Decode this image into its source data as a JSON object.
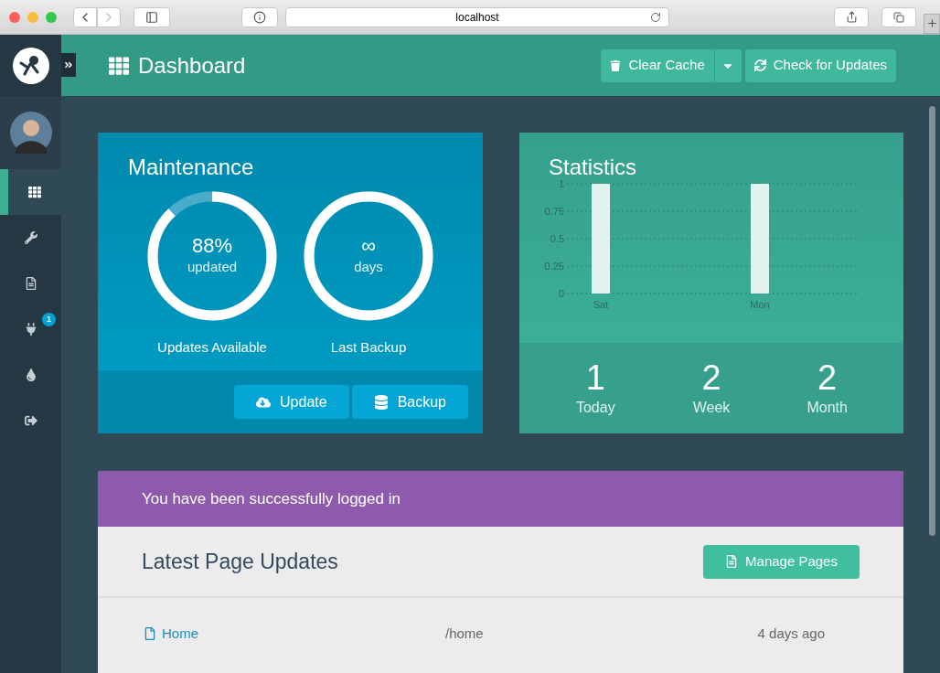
{
  "browser": {
    "url": "localhost"
  },
  "header": {
    "title": "Dashboard",
    "buttons": [
      {
        "kind": "cache",
        "label": "Clear Cache"
      },
      {
        "kind": "updates",
        "label": "Check for Updates"
      }
    ]
  },
  "sidebar": {
    "items": [
      {
        "selected": true
      },
      {
        "selected": false
      },
      {
        "selected": false
      },
      {
        "selected": false,
        "badge": "1"
      },
      {
        "selected": false
      },
      {
        "selected": false
      }
    ]
  },
  "maintenance": {
    "title": "Maintenance",
    "gauges": [
      {
        "value": "88%",
        "unit": "updated",
        "label": "Updates Available",
        "level": 0.88
      },
      {
        "value": "∞",
        "unit": "days",
        "label": "Last Backup",
        "level": 1
      }
    ],
    "buttons": [
      {
        "kind": "update",
        "label": "Update"
      },
      {
        "kind": "backup",
        "label": "Backup"
      }
    ]
  },
  "statistics": {
    "title": "Statistics",
    "chart_data": {
      "type": "bar",
      "grid": true,
      "categories": [
        "Sat",
        "Mon"
      ],
      "values": [
        1,
        1
      ],
      "ylim": [
        0,
        1
      ],
      "yticks": [
        0,
        {
          "value": 0.25,
          "label": "0.25"
        },
        {
          "value": 0.5,
          "label": "0.5"
        },
        {
          "value": 0.75,
          "label": "0.75"
        },
        1
      ]
    },
    "counters": [
      {
        "value": "1",
        "label": "Today"
      },
      {
        "value": "2",
        "label": "Week"
      },
      {
        "value": "2",
        "label": "Month"
      }
    ]
  },
  "alert": {
    "message": "You have been successfully logged in"
  },
  "page_updates": {
    "title": "Latest Page Updates",
    "button": "Manage Pages",
    "rows": [
      {
        "title": "Home",
        "route": "/home",
        "time": "4 days ago"
      }
    ]
  }
}
